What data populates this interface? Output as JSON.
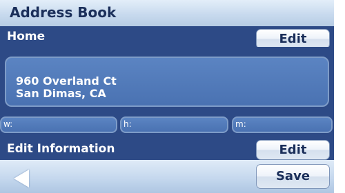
{
  "header": {
    "title": "Address Book"
  },
  "home": {
    "label": "Home",
    "edit_label": "Edit",
    "address_line1": "960 Overland Ct",
    "address_line2": "San Dimas, CA",
    "phone": {
      "work_label": "w:",
      "home_label": "h:",
      "mobile_label": "m:"
    }
  },
  "edit_information": {
    "label": "Edit Information",
    "edit_label": "Edit"
  },
  "footer": {
    "back_icon": "back-arrow-icon",
    "save_label": "Save"
  },
  "colors": {
    "section_bg": "#2d4a86",
    "field_bg": "#4a72b2",
    "title_text": "#1b2f5a",
    "header_bg": "#c8daee"
  }
}
